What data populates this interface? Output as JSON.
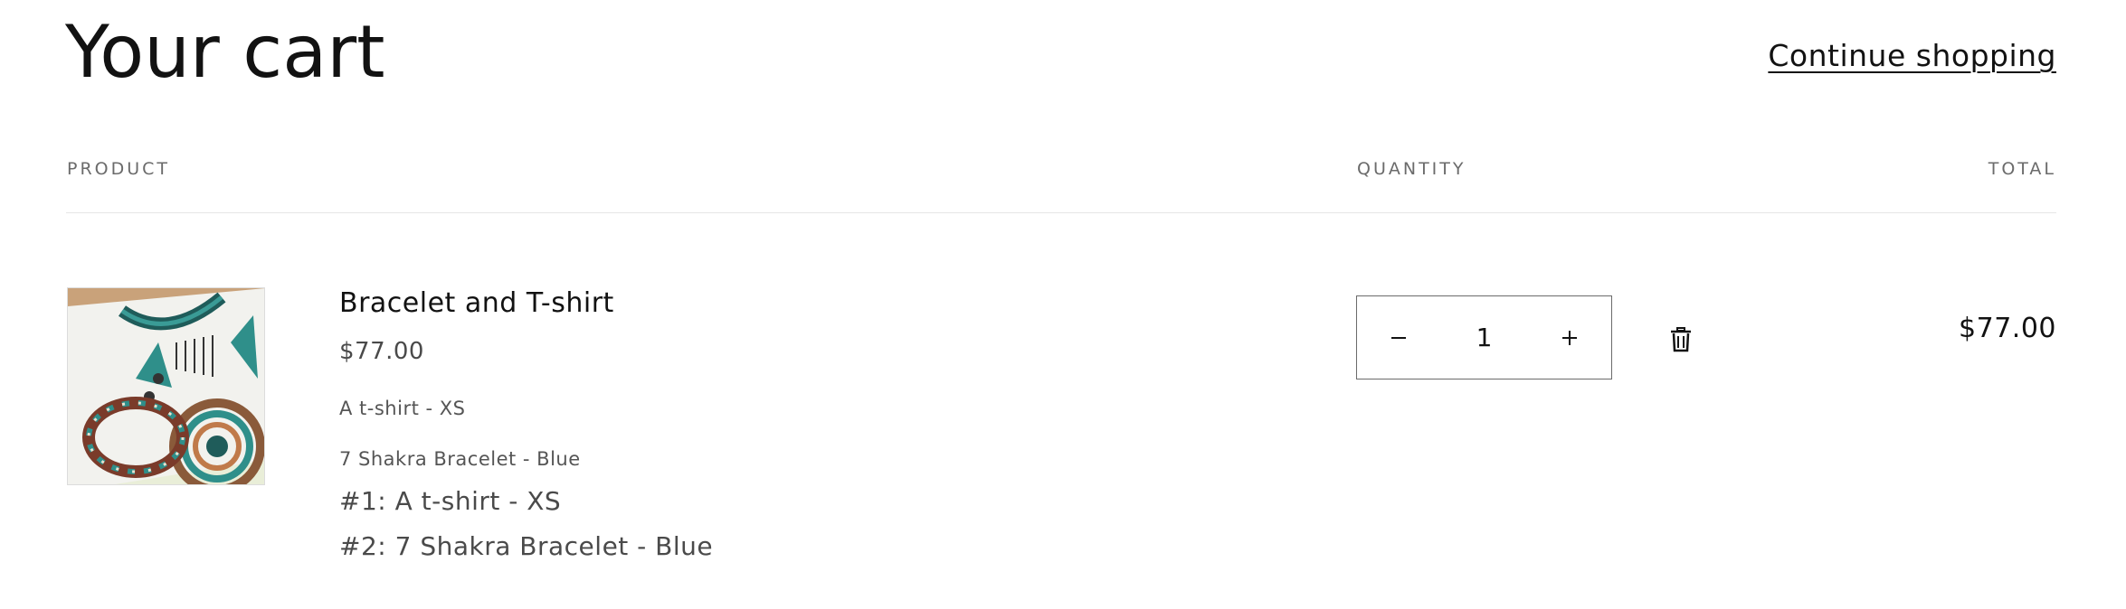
{
  "header": {
    "title": "Your cart",
    "continue_label": "Continue shopping"
  },
  "columns": {
    "product": "PRODUCT",
    "quantity": "QUANTITY",
    "total": "TOTAL"
  },
  "items": [
    {
      "name": "Bracelet and T-shirt",
      "price": "$77.00",
      "options": [
        "A t-shirt - XS",
        "7 Shakra Bracelet - Blue"
      ],
      "bundle_lines": [
        "#1: A t-shirt - XS",
        "#2: 7 Shakra Bracelet - Blue"
      ],
      "quantity": "1",
      "line_total": "$77.00",
      "image_icon": "product-thumbnail",
      "decrease_icon": "minus-icon",
      "increase_icon": "plus-icon",
      "remove_icon": "trash-icon"
    }
  ],
  "colors": {
    "text": "#121212",
    "muted": "#6b6b6b",
    "divider": "#e6e6e6",
    "teal": "#2f8f8a"
  }
}
